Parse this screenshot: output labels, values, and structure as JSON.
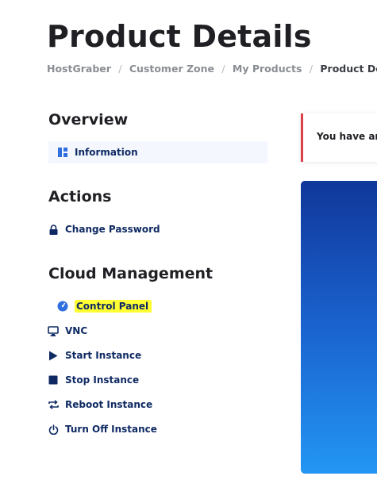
{
  "page": {
    "title": "Product Details"
  },
  "breadcrumb": {
    "items": [
      "HostGraber",
      "Customer Zone",
      "My Products"
    ],
    "separator": "/",
    "current": "Product Details"
  },
  "overview": {
    "title": "Overview",
    "items": [
      {
        "label": "Information",
        "icon": "dashboard-icon",
        "active": true
      }
    ]
  },
  "actions": {
    "title": "Actions",
    "items": [
      {
        "label": "Change Password",
        "icon": "lock-icon"
      }
    ]
  },
  "cloud": {
    "title": "Cloud Management",
    "items": [
      {
        "label": "Control Panel",
        "icon": "speedometer-icon",
        "highlighted": true
      },
      {
        "label": "VNC",
        "icon": "monitor-icon"
      },
      {
        "label": "Start Instance",
        "icon": "play-icon"
      },
      {
        "label": "Stop Instance",
        "icon": "stop-icon"
      },
      {
        "label": "Reboot Instance",
        "icon": "reboot-icon"
      },
      {
        "label": "Turn Off Instance",
        "icon": "power-icon"
      }
    ]
  },
  "alert": {
    "text": "You have an"
  },
  "colors": {
    "nav_text": "#0f2a63",
    "alert_border": "#d9404a",
    "highlight": "#ffff33",
    "hero_top": "#10379a",
    "hero_bottom": "#2396f3",
    "icon_blue": "#2f6fe0"
  }
}
